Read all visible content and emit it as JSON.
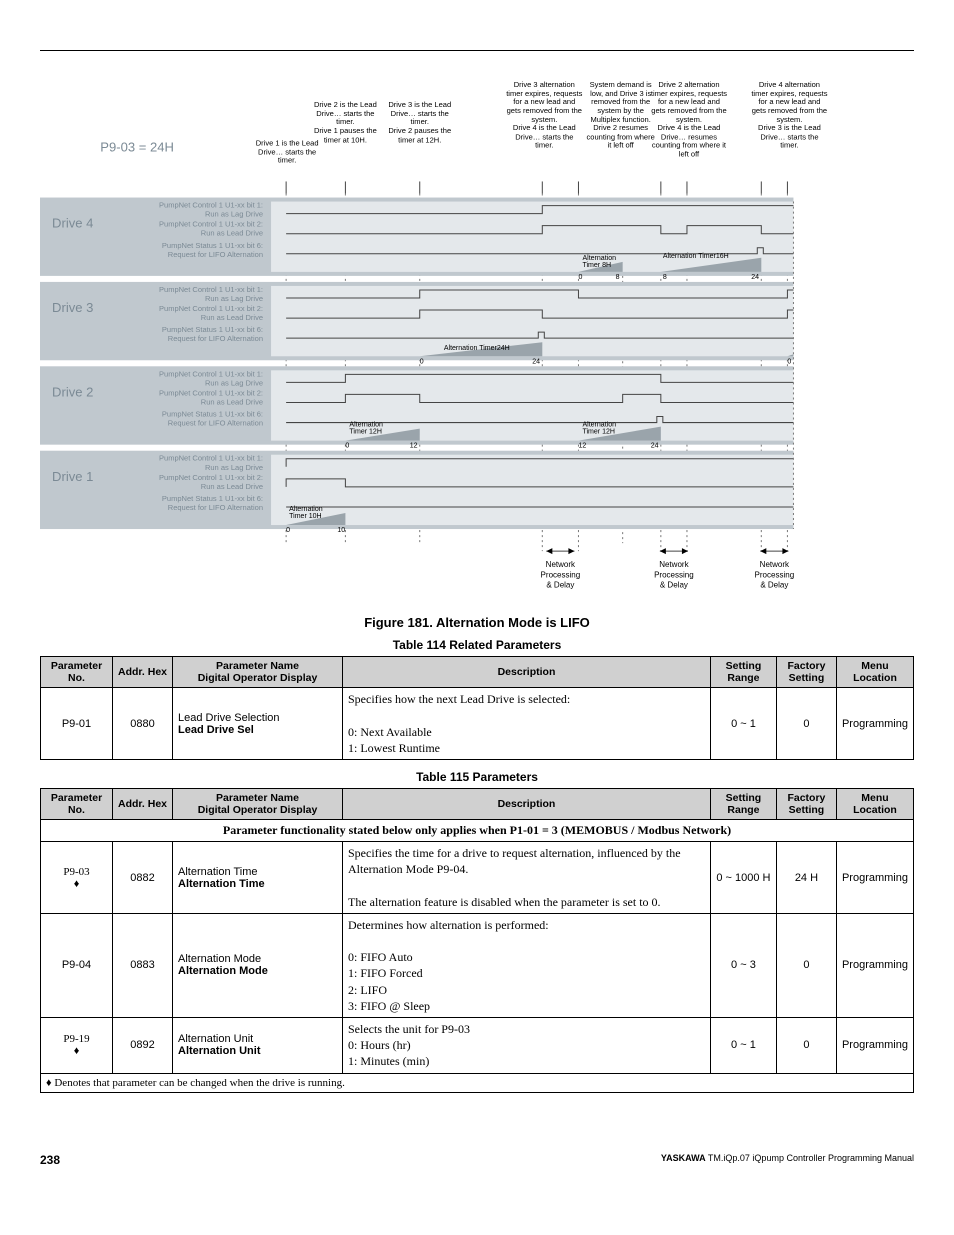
{
  "figure": {
    "p9_label": "P9-03 = 24H",
    "annotations": [
      "Drive 1 is the Lead Drive… starts the timer.",
      "Drive 2 is the Lead Drive… starts the timer.\nDrive 1 pauses the timer at 10H.",
      "Drive 3 is the Lead Drive… starts the timer.\nDrive 2 pauses the timer at 12H.",
      "Drive 3 alternation timer expires, requests for a new lead and gets removed from the system.\nDrive 4 is the Lead Drive… starts the timer.",
      "System demand is low, and Drive 3 is removed from the system by the Multiplex function.\nDrive 2 resumes counting from where it left off",
      "Drive 2 alternation timer expires, requests for a new lead and gets removed from the system.\nDrive 4 is the Lead Drive… resumes counting from where it left off",
      "Drive 4 alternation timer expires, requests for a new lead and gets removed from the system.\nDrive 3 is the Lead Drive… starts the timer."
    ],
    "rows": [
      {
        "name": "Drive 4"
      },
      {
        "name": "Drive 3"
      },
      {
        "name": "Drive 2"
      },
      {
        "name": "Drive 1"
      }
    ],
    "sub_labels": [
      "PumpNet Control 1 U1-xx bit 1:",
      "Run as Lag Drive",
      "PumpNet Control 1 U1-xx bit 2:",
      "Run as Lead Drive",
      "PumpNet Status 1 U1-xx bit 6:",
      "Request for LIFO Alternation"
    ],
    "network_label": "Network Processing & Delay",
    "timer_labels": {
      "t10": "Alternation Timer 10H",
      "t12": "Alternation Timer 12H",
      "t24": "Alternation Timer24H",
      "t16": "Alternation Timer16H",
      "t8": "Alternation Timer 8H"
    },
    "caption": "Figure 181.  Alternation Mode is LIFO"
  },
  "table114": {
    "caption": "Table 114  Related Parameters",
    "headers": [
      "Parameter No.",
      "Addr. Hex",
      "Parameter Name\nDigital Operator Display",
      "Description",
      "Setting Range",
      "Factory Setting",
      "Menu Location"
    ],
    "rows": [
      {
        "pno": "P9-01",
        "addr": "0880",
        "name_top": "Lead Drive Selection",
        "name_bold": "Lead Drive Sel",
        "desc": "Specifies how the next Lead Drive is selected:\n\n0: Next Available\n1: Lowest Runtime",
        "range": "0 ~ 1",
        "factory": "0",
        "menu": "Programming"
      }
    ]
  },
  "table115": {
    "caption": "Table 115  Parameters",
    "headers": [
      "Parameter No.",
      "Addr. Hex",
      "Parameter Name\nDigital Operator Display",
      "Description",
      "Setting Range",
      "Factory Setting",
      "Menu Location"
    ],
    "banner": "Parameter functionality stated below only applies when P1-01 = 3 (MEMOBUS / Modbus Network)",
    "rows": [
      {
        "pno": "P9-03\n♦",
        "addr": "0882",
        "name_top": "Alternation Time",
        "name_bold": "Alternation Time",
        "desc": "Specifies the time for a drive to request alternation, influenced by the Alternation Mode P9-04.\n\nThe alternation feature is disabled when the parameter is set to 0.",
        "range": "0 ~ 1000 H",
        "factory": "24 H",
        "menu": "Programming"
      },
      {
        "pno": "P9-04",
        "addr": "0883",
        "name_top": "Alternation Mode",
        "name_bold": "Alternation Mode",
        "desc": "Determines how alternation is performed:\n\n0: FIFO Auto\n1: FIFO Forced\n2: LIFO\n3: FIFO @ Sleep",
        "range": "0 ~ 3",
        "factory": "0",
        "menu": "Programming"
      },
      {
        "pno": "P9-19\n♦",
        "addr": "0892",
        "name_top": "Alternation Unit",
        "name_bold": "Alternation Unit",
        "desc": "Selects the unit for P9-03\n0: Hours (hr)\n1: Minutes (min)",
        "range": "0 ~ 1",
        "factory": "0",
        "menu": "Programming"
      }
    ],
    "footnote": "♦ Denotes that parameter can be changed when the drive is running."
  },
  "footer": {
    "page": "238",
    "brand": "YASKAWA",
    "doc": "TM.iQp.07 iQpump Controller Programming Manual"
  }
}
